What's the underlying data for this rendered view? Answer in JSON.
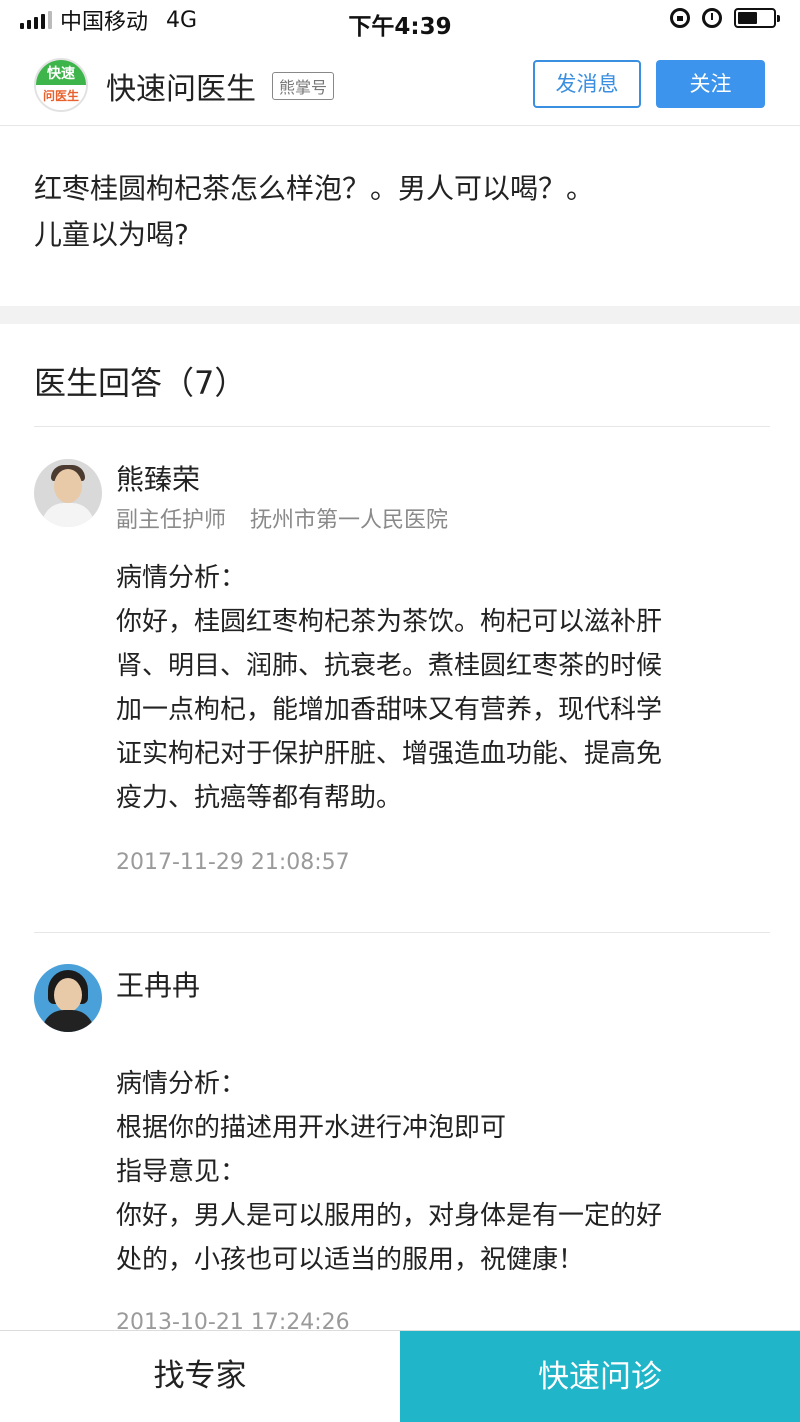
{
  "status_bar": {
    "carrier": "中国移动",
    "network": "4G",
    "time": "下午4:39",
    "battery_level": 0.55
  },
  "header": {
    "logo_text_top": "快速",
    "logo_text_bottom": "问医生",
    "app_name": "快速问医生",
    "badge": "熊掌号",
    "message_button": "发消息",
    "follow_button": "关注"
  },
  "question": {
    "line1": "红枣桂圆枸杞茶怎么样泡？。男人可以喝？。",
    "line2": "儿童以为喝?"
  },
  "answers_section": {
    "title": "医生回答（7）"
  },
  "answers": [
    {
      "name": "熊臻荣",
      "title": "副主任护师",
      "hospital": "抚州市第一人民医院",
      "lines": [
        "病情分析：",
        "你好，桂圆红枣枸杞茶为茶饮。枸杞可以滋补肝",
        "肾、明目、润肺、抗衰老。煮桂圆红枣茶的时候",
        "加一点枸杞，能增加香甜味又有营养，现代科学",
        "证实枸杞对于保护肝脏、增强造血功能、提高免",
        "疫力、抗癌等都有帮助。"
      ],
      "timestamp": "2017-11-29 21:08:57"
    },
    {
      "name": "王冉冉",
      "lines": [
        "病情分析：",
        "根据你的描述用开水进行冲泡即可",
        "指导意见：",
        "你好，男人是可以服用的，对身体是有一定的好",
        "处的，小孩也可以适当的服用，祝健康！"
      ],
      "timestamp": "2013-10-21 17:24:26"
    }
  ],
  "bottom_bar": {
    "find_expert": "找专家",
    "quick_consult": "快速问诊"
  },
  "colors": {
    "primary_blue": "#3c94ec",
    "teal": "#20b5c9",
    "logo_green": "#3eb54a"
  }
}
